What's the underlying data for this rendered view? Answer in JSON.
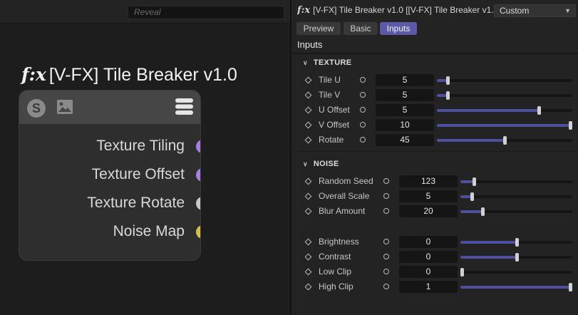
{
  "graph": {
    "search_placeholder": "Reveal",
    "node": {
      "fx_glyph": "f:x",
      "title": "[V-FX] Tile Breaker v1.0",
      "ports": [
        {
          "label": "Texture Tiling",
          "color": "#a77ee0"
        },
        {
          "label": "Texture Offset",
          "color": "#a77ee0"
        },
        {
          "label": "Texture Rotate",
          "color": "#c9c9c9"
        },
        {
          "label": "Noise Map",
          "color": "#d4bf4a"
        }
      ],
      "header_icons": [
        "s-icon",
        "image-icon",
        "menu-icon"
      ]
    }
  },
  "panel": {
    "fx_glyph": "f:x",
    "title": "[V-FX] Tile Breaker v1.0 [[V-FX] Tile Breaker v1.",
    "preset_value": "Custom",
    "tabs": [
      "Preview",
      "Basic",
      "Inputs"
    ],
    "active_tab": "Inputs",
    "heading": "Inputs",
    "accent_color": "#5a5aa8",
    "sections": [
      {
        "title": "TEXTURE",
        "params": [
          {
            "label": "Tile U",
            "value": "5",
            "fraction": 0.08
          },
          {
            "label": "Tile V",
            "value": "5",
            "fraction": 0.08
          },
          {
            "label": "U Offset",
            "value": "5",
            "fraction": 0.75
          },
          {
            "label": "V Offset",
            "value": "10",
            "fraction": 1.0
          },
          {
            "label": "Rotate",
            "value": "45",
            "fraction": 0.5
          }
        ]
      },
      {
        "title": "NOISE",
        "params": [
          {
            "label": "Random Seed",
            "value": "123",
            "fraction": 0.12
          },
          {
            "label": "Overall Scale",
            "value": "5",
            "fraction": 0.1
          },
          {
            "label": "Blur Amount",
            "value": "20",
            "fraction": 0.2
          },
          {
            "label": "Brightness",
            "value": "0",
            "fraction": 0.5
          },
          {
            "label": "Contrast",
            "value": "0",
            "fraction": 0.5
          },
          {
            "label": "Low Clip",
            "value": "0",
            "fraction": 0.0
          },
          {
            "label": "High Clip",
            "value": "1",
            "fraction": 1.0
          }
        ]
      }
    ]
  }
}
